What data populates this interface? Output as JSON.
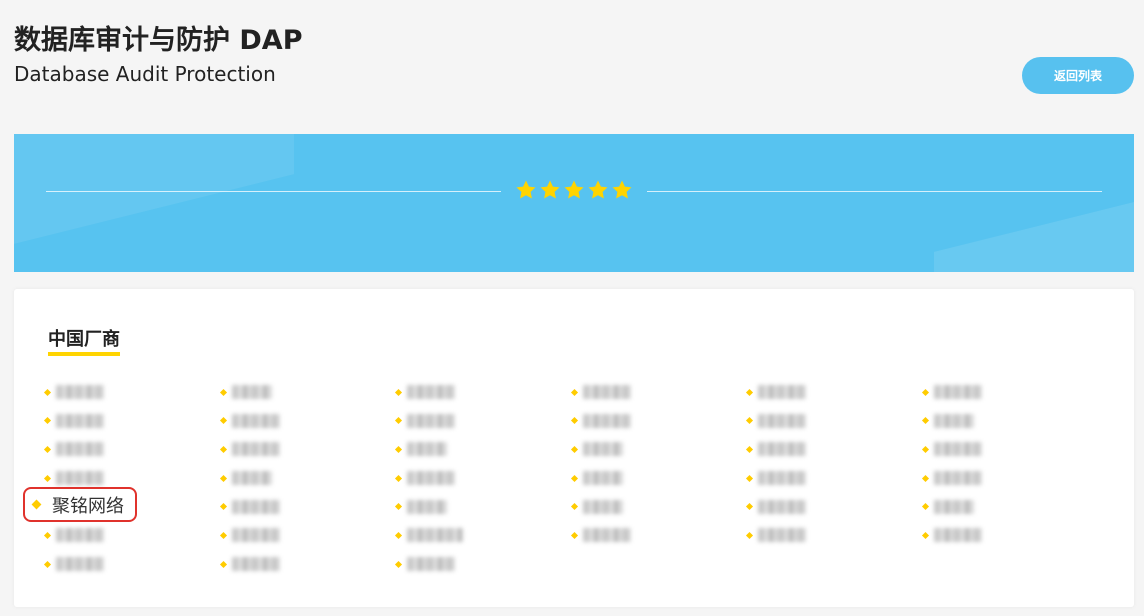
{
  "header": {
    "title": "数据库审计与防护 DAP",
    "subtitle": "Database Audit Protection",
    "back_button_label": "返回列表"
  },
  "banner": {
    "stars": 5,
    "star_color": "#ffd400",
    "background_color": "#57c3f0"
  },
  "vendor_section": {
    "title": "中国厂商",
    "underline_color": "#ffd400",
    "highlighted_vendor": "聚铭网络",
    "highlight_color": "#e0322c",
    "columns": [
      [
        "w48",
        "w48",
        "w48",
        "w48",
        "",
        "w48",
        "w48"
      ],
      [
        "w40",
        "w48",
        "w48",
        "w40",
        "w48",
        "w48",
        "w48"
      ],
      [
        "w48",
        "w48",
        "w40",
        "w48",
        "w40",
        "w56",
        "w48"
      ],
      [
        "w48",
        "w48",
        "w40",
        "w40",
        "w40",
        "w48"
      ],
      [
        "w48",
        "w48",
        "w48",
        "w48",
        "w48",
        "w48"
      ],
      [
        "w48",
        "w40",
        "w48",
        "w48",
        "w40",
        "w48"
      ]
    ]
  }
}
